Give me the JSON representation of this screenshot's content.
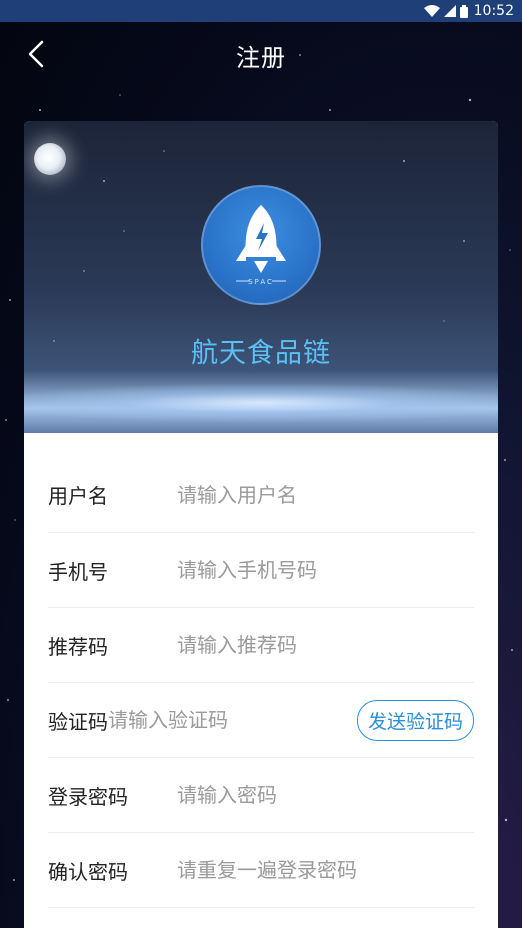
{
  "status_bar": {
    "time": "10:52"
  },
  "header": {
    "title": "注册"
  },
  "banner": {
    "app_name": "航天食品链",
    "logo_text": "SPAC"
  },
  "form": {
    "fields": [
      {
        "label": "用户名",
        "placeholder": "请输入用户名"
      },
      {
        "label": "手机号",
        "placeholder": "请输入手机号码"
      },
      {
        "label": "推荐码",
        "placeholder": "请输入推荐码"
      },
      {
        "label": "验证码",
        "placeholder": "请输入验证码"
      },
      {
        "label": "登录密码",
        "placeholder": "请输入密码"
      },
      {
        "label": "确认密码",
        "placeholder": "请重复一遍登录密码"
      }
    ],
    "send_code_label": "发送验证码"
  },
  "colors": {
    "accent": "#2a8ed8",
    "app_name": "#5cc0f4",
    "status_bar": "#1f3f78"
  }
}
